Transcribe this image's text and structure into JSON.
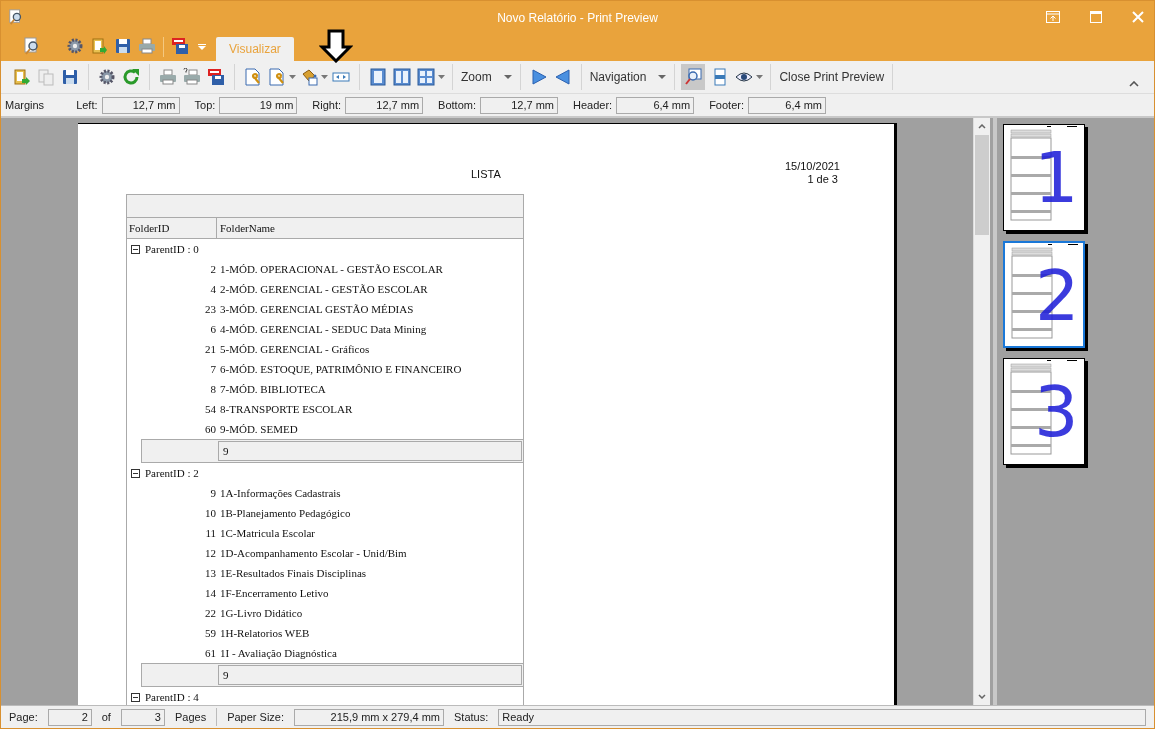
{
  "window": {
    "title": "Novo Relatório - Print Preview"
  },
  "ribbon": {
    "tabs": [
      {
        "label": "Visualizar",
        "selected": true
      }
    ]
  },
  "toolbar": {
    "zoom_label": "Zoom",
    "navigation_label": "Navigation",
    "close_label": "Close Print Preview",
    "magnifier_pressed": true
  },
  "margins": {
    "label": "Margins",
    "fields": [
      {
        "label": "Left:",
        "value": "12,7 mm"
      },
      {
        "label": "Top:",
        "value": "19 mm"
      },
      {
        "label": "Right:",
        "value": "12,7 mm"
      },
      {
        "label": "Bottom:",
        "value": "12,7 mm"
      },
      {
        "label": "Header:",
        "value": "6,4 mm"
      },
      {
        "label": "Footer:",
        "value": "6,4 mm"
      }
    ]
  },
  "report": {
    "title": "LISTA",
    "date": "15/10/2021",
    "page_info": "1 de 3",
    "columns": [
      "FolderID",
      "FolderName"
    ],
    "groups": [
      {
        "label": "ParentID : 0",
        "expanded": true,
        "rows": [
          {
            "id": "2",
            "name": "1-MÓD. OPERACIONAL - GESTÃO ESCOLAR"
          },
          {
            "id": "4",
            "name": "2-MÓD. GERENCIAL - GESTÃO ESCOLAR"
          },
          {
            "id": "23",
            "name": "3-MÓD. GERENCIAL GESTÃO MÉDIAS"
          },
          {
            "id": "6",
            "name": "4-MÓD. GERENCIAL - SEDUC Data Mining"
          },
          {
            "id": "21",
            "name": "5-MÓD. GERENCIAL - Gráficos"
          },
          {
            "id": "7",
            "name": "6-MÓD. ESTOQUE, PATRIMÔNIO E FINANCEIRO"
          },
          {
            "id": "8",
            "name": "7-MÓD. BIBLIOTECA"
          },
          {
            "id": "54",
            "name": "8-TRANSPORTE ESCOLAR"
          },
          {
            "id": "60",
            "name": "9-MÓD. SEMED"
          }
        ],
        "summary": "9"
      },
      {
        "label": "ParentID : 2",
        "expanded": true,
        "rows": [
          {
            "id": "9",
            "name": "1A-Informações Cadastrais"
          },
          {
            "id": "10",
            "name": "1B-Planejamento Pedagógico"
          },
          {
            "id": "11",
            "name": "1C-Matricula Escolar"
          },
          {
            "id": "12",
            "name": "1D-Acompanhamento Escolar - Unid/Bim"
          },
          {
            "id": "13",
            "name": "1E-Resultados Finais Disciplinas"
          },
          {
            "id": "14",
            "name": "1F-Encerramento Letivo"
          },
          {
            "id": "22",
            "name": "1G-Livro Didático"
          },
          {
            "id": "59",
            "name": "1H-Relatorios WEB"
          },
          {
            "id": "61",
            "name": "1I - Avaliação Diagnóstica"
          }
        ],
        "summary": "9"
      },
      {
        "label": "ParentID : 4",
        "expanded": true
      }
    ]
  },
  "thumbnails": [
    {
      "label": "1",
      "selected": false
    },
    {
      "label": "2",
      "selected": true
    },
    {
      "label": "3",
      "selected": false
    }
  ],
  "status_bar": {
    "page_label": "Page:",
    "page": "2",
    "of_label": "of",
    "pages": "3",
    "pages_label": "Pages",
    "paper_label": "Paper Size:",
    "paper": "215,9 mm x 279,4 mm",
    "status_label": "Status:",
    "status": "Ready"
  }
}
